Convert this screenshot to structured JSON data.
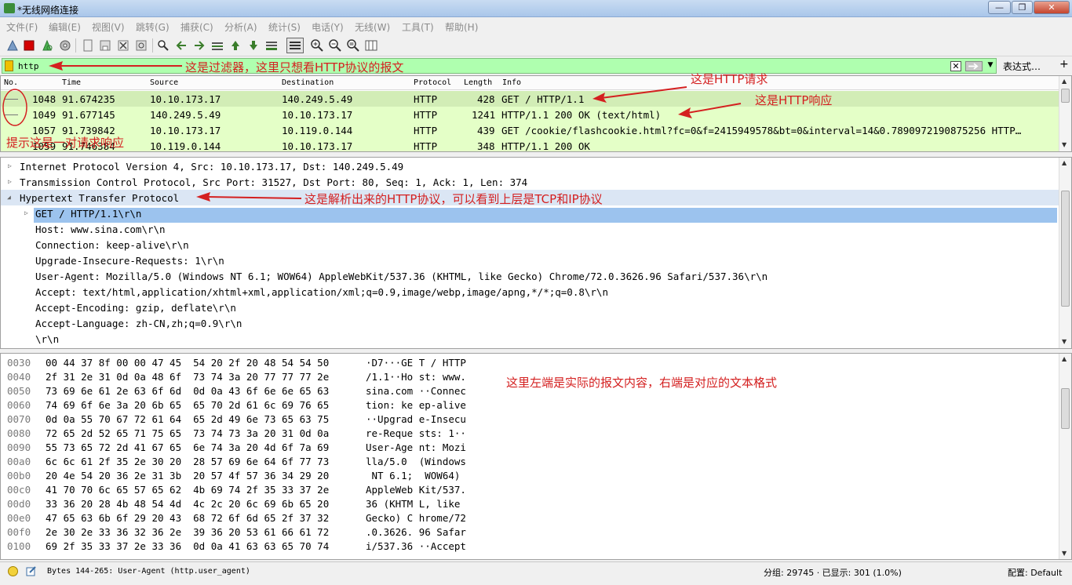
{
  "window": {
    "title": "*无线网络连接",
    "controls": [
      "—",
      "❐",
      "✕"
    ]
  },
  "menu": [
    "文件(F)",
    "编辑(E)",
    "视图(V)",
    "跳转(G)",
    "捕获(C)",
    "分析(A)",
    "统计(S)",
    "电话(Y)",
    "无线(W)",
    "工具(T)",
    "帮助(H)"
  ],
  "toolbar_icons": [
    "shark-fin-icon",
    "stop-icon",
    "restart-icon",
    "options-gear-icon",
    "open-file-icon",
    "save-file-icon",
    "close-file-icon",
    "reload-icon",
    "find-icon",
    "back-arrow-icon",
    "forward-arrow-icon",
    "goto-packet-icon",
    "first-packet-icon",
    "last-packet-icon",
    "autoscroll-icon",
    "colorize-icon",
    "zoom-in-icon",
    "zoom-out-icon",
    "zoom-normal-icon",
    "resize-columns-icon"
  ],
  "filter": {
    "value": "http",
    "expression_label": "表达式…",
    "add_label": "+"
  },
  "packet_list": {
    "columns": [
      "No.",
      "Time",
      "Source",
      "Destination",
      "Protocol",
      "Length",
      "Info"
    ],
    "rows": [
      {
        "no": "1048",
        "time": "91.674235",
        "src": "10.10.173.17",
        "dst": "140.249.5.49",
        "proto": "HTTP",
        "len": "428",
        "info": "GET / HTTP/1.1"
      },
      {
        "no": "1049",
        "time": "91.677145",
        "src": "140.249.5.49",
        "dst": "10.10.173.17",
        "proto": "HTTP",
        "len": "1241",
        "info": "HTTP/1.1 200 OK  (text/html)"
      },
      {
        "no": "1057",
        "time": "91.739842",
        "src": "10.10.173.17",
        "dst": "10.119.0.144",
        "proto": "HTTP",
        "len": "439",
        "info": "GET /cookie/flashcookie.html?fc=0&f=2415949578&bt=0&interval=14&0.7890972190875256 HTTP…"
      },
      {
        "no": "1059",
        "time": "91.746384",
        "src": "10.119.0.144",
        "dst": "10.10.173.17",
        "proto": "HTTP",
        "len": "348",
        "info": "HTTP/1.1 200 OK"
      }
    ]
  },
  "details": [
    {
      "text": "Internet Protocol Version 4, Src: 10.10.173.17, Dst: 140.249.5.49",
      "arrow": "▷",
      "indent": 0
    },
    {
      "text": "Transmission Control Protocol, Src Port: 31527, Dst Port: 80, Seq: 1, Ack: 1, Len: 374",
      "arrow": "▷",
      "indent": 0
    },
    {
      "text": "Hypertext Transfer Protocol",
      "arrow": "◢",
      "indent": 0
    },
    {
      "text": "GET / HTTP/1.1\\r\\n",
      "arrow": "▷",
      "indent": 1
    },
    {
      "text": "Host: www.sina.com\\r\\n",
      "arrow": "",
      "indent": 1
    },
    {
      "text": "Connection: keep-alive\\r\\n",
      "arrow": "",
      "indent": 1
    },
    {
      "text": "Upgrade-Insecure-Requests: 1\\r\\n",
      "arrow": "",
      "indent": 1
    },
    {
      "text": "User-Agent: Mozilla/5.0 (Windows NT 6.1; WOW64) AppleWebKit/537.36 (KHTML, like Gecko) Chrome/72.0.3626.96 Safari/537.36\\r\\n",
      "arrow": "",
      "indent": 1
    },
    {
      "text": "Accept: text/html,application/xhtml+xml,application/xml;q=0.9,image/webp,image/apng,*/*;q=0.8\\r\\n",
      "arrow": "",
      "indent": 1
    },
    {
      "text": "Accept-Encoding: gzip, deflate\\r\\n",
      "arrow": "",
      "indent": 1
    },
    {
      "text": "Accept-Language: zh-CN,zh;q=0.9\\r\\n",
      "arrow": "",
      "indent": 1
    },
    {
      "text": "\\r\\n",
      "arrow": "",
      "indent": 1
    }
  ],
  "bytes": [
    {
      "off": "0030",
      "hex": "00 44 37 8f 00 00 47 45  54 20 2f 20 48 54 54 50",
      "ascii": "·D7···GE T / HTTP"
    },
    {
      "off": "0040",
      "hex": "2f 31 2e 31 0d 0a 48 6f  73 74 3a 20 77 77 77 2e",
      "ascii": "/1.1··Ho st: www."
    },
    {
      "off": "0050",
      "hex": "73 69 6e 61 2e 63 6f 6d  0d 0a 43 6f 6e 6e 65 63",
      "ascii": "sina.com ··Connec"
    },
    {
      "off": "0060",
      "hex": "74 69 6f 6e 3a 20 6b 65  65 70 2d 61 6c 69 76 65",
      "ascii": "tion: ke ep-alive"
    },
    {
      "off": "0070",
      "hex": "0d 0a 55 70 67 72 61 64  65 2d 49 6e 73 65 63 75",
      "ascii": "··Upgrad e-Insecu"
    },
    {
      "off": "0080",
      "hex": "72 65 2d 52 65 71 75 65  73 74 73 3a 20 31 0d 0a",
      "ascii": "re-Reque sts: 1··"
    },
    {
      "off": "0090",
      "hex": "55 73 65 72 2d 41 67 65  6e 74 3a 20 4d 6f 7a 69",
      "ascii": "User-Age nt: Mozi"
    },
    {
      "off": "00a0",
      "hex": "6c 6c 61 2f 35 2e 30 20  28 57 69 6e 64 6f 77 73",
      "ascii": "lla/5.0  (Windows"
    },
    {
      "off": "00b0",
      "hex": "20 4e 54 20 36 2e 31 3b  20 57 4f 57 36 34 29 20",
      "ascii": " NT 6.1;  WOW64) "
    },
    {
      "off": "00c0",
      "hex": "41 70 70 6c 65 57 65 62  4b 69 74 2f 35 33 37 2e",
      "ascii": "AppleWeb Kit/537."
    },
    {
      "off": "00d0",
      "hex": "33 36 20 28 4b 48 54 4d  4c 2c 20 6c 69 6b 65 20",
      "ascii": "36 (KHTM L, like "
    },
    {
      "off": "00e0",
      "hex": "47 65 63 6b 6f 29 20 43  68 72 6f 6d 65 2f 37 32",
      "ascii": "Gecko) C hrome/72"
    },
    {
      "off": "00f0",
      "hex": "2e 30 2e 33 36 32 36 2e  39 36 20 53 61 66 61 72",
      "ascii": ".0.3626. 96 Safar"
    },
    {
      "off": "0100",
      "hex": "69 2f 35 33 37 2e 33 36  0d 0a 41 63 63 65 70 74",
      "ascii": "i/537.36 ··Accept"
    }
  ],
  "status": {
    "field": "Bytes 144-265: User-Agent (http.user_agent)",
    "packets": "分组: 29745 · 已显示: 301 (1.0%)",
    "profile": "配置: Default"
  },
  "annotations": {
    "filter": "这是过滤器，这里只想看HTTP协议的报文",
    "request": "这是HTTP请求",
    "response": "这是HTTP响应",
    "pair": "提示这是一对请求响应",
    "parsed": "这是解析出来的HTTP协议，可以看到上层是TCP和IP协议",
    "bytes": "这里左端是实际的报文内容，右端是对应的文本格式"
  },
  "colors": {
    "filter_bg": "#afffaf",
    "row_bg": "#e4ffc7",
    "selection": "#9cc3ee",
    "annotation": "#d42020"
  }
}
